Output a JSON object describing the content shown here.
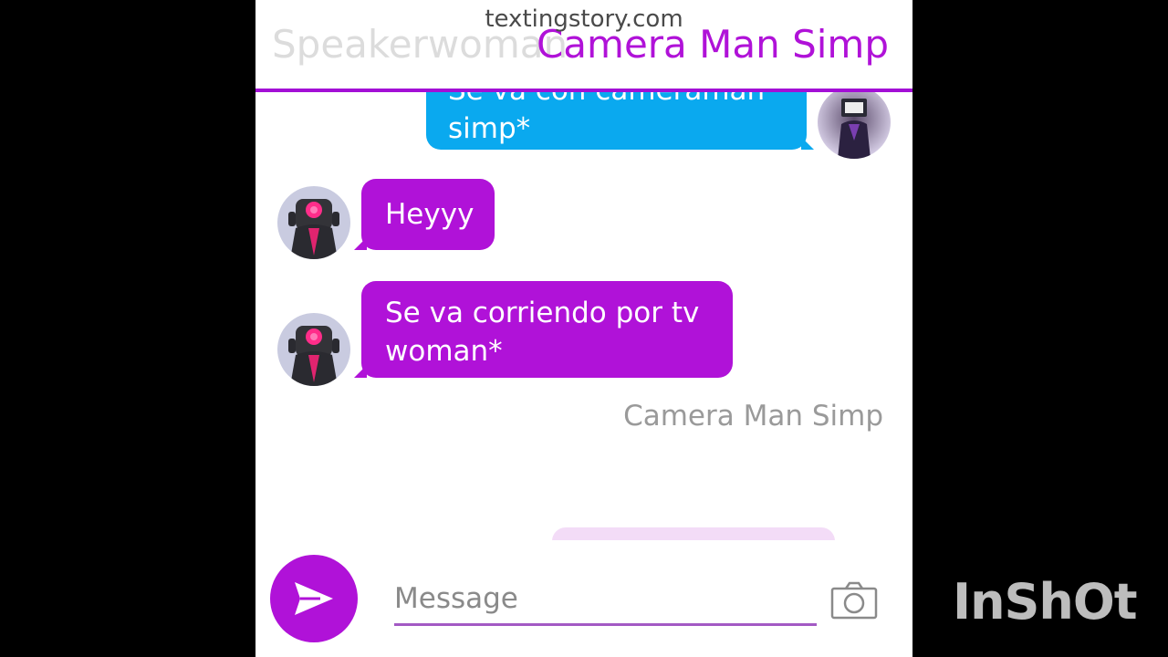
{
  "watermark": {
    "site": "textingstory.com",
    "app_logo": "InShOt"
  },
  "header": {
    "previous_contact": "Speakerwoman",
    "contact_name": "Camera Man Simp",
    "accent_color": "#b012d8"
  },
  "messages": [
    {
      "side": "right",
      "text": "Se va con cameraman simp*",
      "color": "#0aa9ef"
    },
    {
      "side": "left",
      "text": "Heyyy",
      "color": "#b012d8"
    },
    {
      "side": "left",
      "text": "Se va corriendo por tv woman*",
      "color": "#b012d8"
    }
  ],
  "sender_caption": "Camera Man Simp",
  "composer": {
    "placeholder": "Message",
    "send_icon": "send-icon",
    "camera_icon": "camera-icon"
  }
}
